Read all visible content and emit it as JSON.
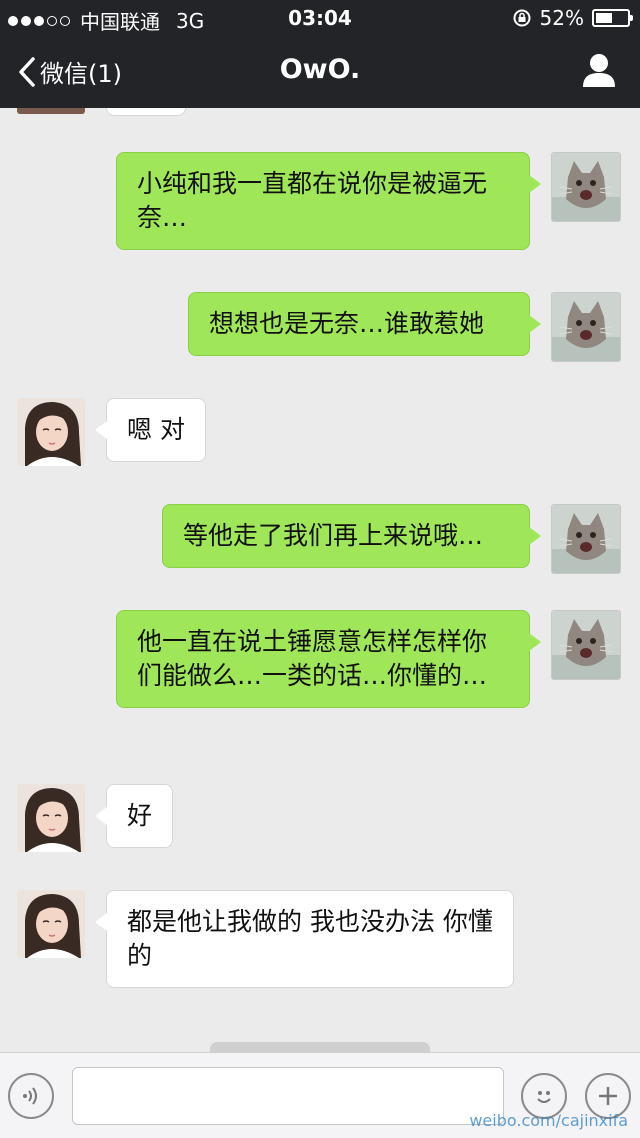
{
  "statusbar": {
    "carrier": "中国联通",
    "network": "3G",
    "time": "03:04",
    "battery": "52%",
    "battery_level": 0.52
  },
  "navbar": {
    "back_label": "微信(1)",
    "title": "OwO."
  },
  "messages": [
    {
      "sender": "me",
      "text": "小纯和我一直都在说你是被逼无奈…"
    },
    {
      "sender": "me",
      "text": "想想也是无奈…谁敢惹她"
    },
    {
      "sender": "other",
      "text": "嗯 对"
    },
    {
      "sender": "me",
      "text": "等他走了我们再上来说哦…"
    },
    {
      "sender": "me",
      "text": "他一直在说土锤愿意怎样怎样你们能做么…一类的话…你懂的…"
    },
    {
      "sender": "other",
      "text": "好"
    },
    {
      "sender": "other",
      "text": "都是他让我做的 我也没办法 你懂的"
    }
  ],
  "inputbar": {
    "placeholder": ""
  },
  "watermark": {
    "text": "weibo.com/cajinxifa"
  },
  "colors": {
    "bar_bg": "#232428",
    "chat_bg": "#ebebeb",
    "me_bubble": "#9fe658",
    "other_bubble": "#ffffff"
  }
}
